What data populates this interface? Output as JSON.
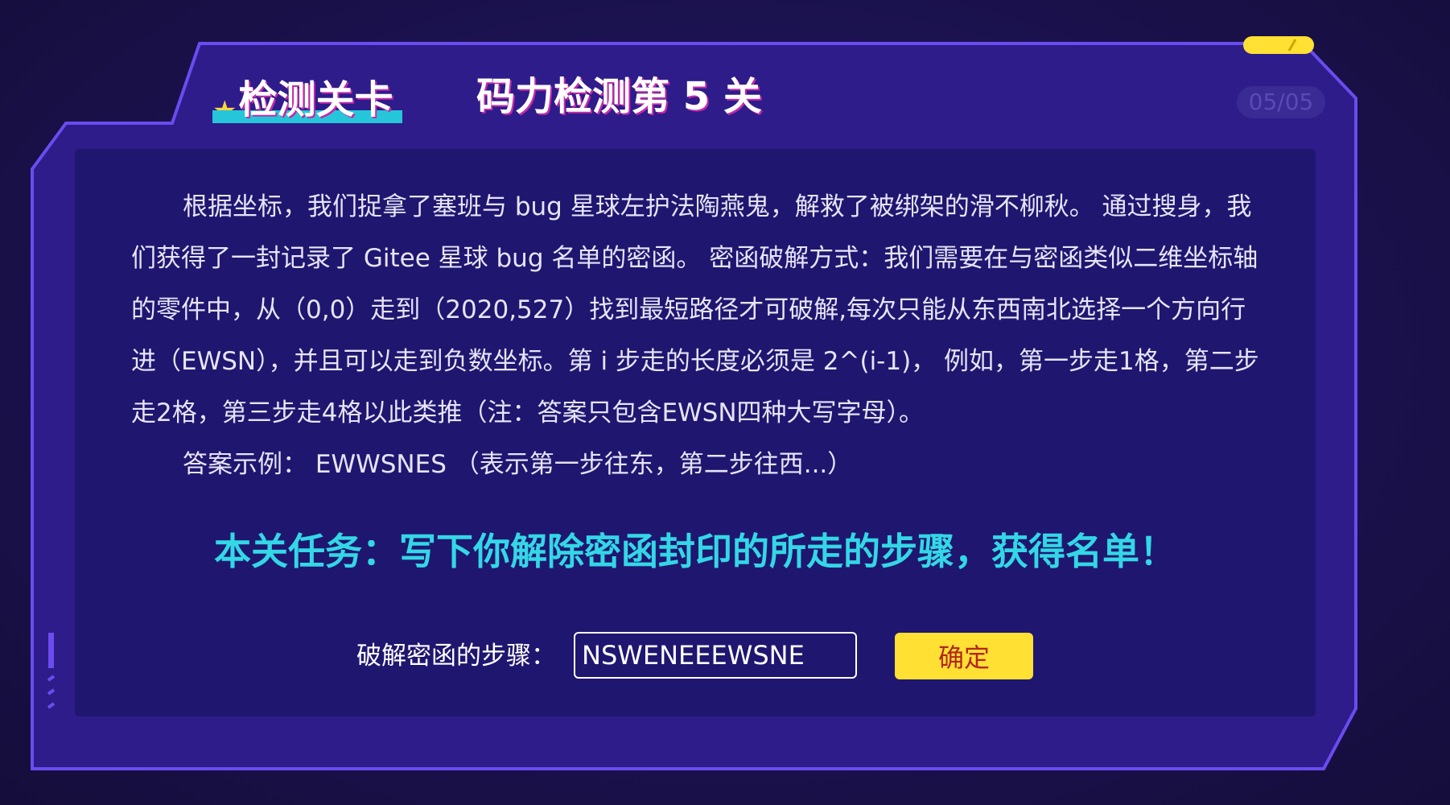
{
  "header": {
    "tab_label": "检测关卡",
    "title": "码力检测第 5 关",
    "page_counter": "05/05"
  },
  "story": {
    "paragraph_1": "根据坐标，我们捉拿了塞班与 bug 星球左护法陶燕鬼，解救了被绑架的滑不柳秋。 通过搜身，我们获得了一封记录了 Gitee 星球 bug 名单的密函。 密函破解方式：我们需要在与密函类似二维坐标轴的零件中，从（0,0）走到（2020,527）找到最短路径才可破解,每次只能从东西南北选择一个方向行进（EWSN），并且可以走到负数坐标。第 i 步走的长度必须是 2^(i-1)， 例如，第一步走1格，第二步走2格，第三步走4格以此类推（注：答案只包含EWSN四种大写字母）。",
    "paragraph_2": "答案示例： EWWSNES （表示第一步往东，第二步往西...）"
  },
  "mission": {
    "text": "本关任务：写下你解除密函封印的所走的步骤，获得名单！"
  },
  "answer": {
    "label": "破解密函的步骤：",
    "value": "NSWENEEEWSNE",
    "submit_label": "确定"
  },
  "colors": {
    "background": "#1b1250",
    "frame_border": "#6a4cf0",
    "panel": "#1f1670",
    "accent_cyan": "#26c6da",
    "mission_text": "#33d7e6",
    "button_yellow": "#ffe033",
    "button_text": "#b3261e",
    "tab_shadow": "#c52aa8"
  },
  "icons": {
    "tab_icon": "star-icon"
  }
}
